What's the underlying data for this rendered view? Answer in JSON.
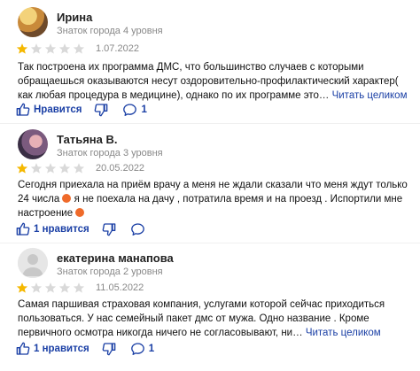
{
  "reviews": [
    {
      "name": "Ирина",
      "level": "Знаток города 4 уровня",
      "rating": 1,
      "date": "1.07.2022",
      "text": "Так построена их программа ДМС, что большинство случаев с которыми обращаешься оказываются несут оздоровительно-профилактический характер( как любая процедура в медицине), однако по их программе это…",
      "more": "Читать целиком",
      "likes": "Нравится",
      "comments": "1"
    },
    {
      "name": "Татьяна В.",
      "level": "Знаток города 3 уровня",
      "rating": 1,
      "date": "20.05.2022",
      "text_part1": "Сегодня приехала на приём врачу а меня не ждали сказали что меня ждут только 24 числа",
      "text_part2": "я не поехала на дачу , потратила время и на проезд . Испортили мне настроение",
      "likes": "1 нравится",
      "comments": ""
    },
    {
      "name": "екатерина манапова",
      "level": "Знаток города 2 уровня",
      "rating": 1,
      "date": "11.05.2022",
      "text": "Самая паршивая страховая компания, услугами которой сейчас приходиться пользоваться. У нас семейный пакет дмс от мужа. Одно название . Кроме первичного осмотра никогда ничего не согласовывают, ни…",
      "more": "Читать целиком",
      "likes": "1 нравится",
      "comments": "1"
    }
  ],
  "colors": {
    "star_filled": "#f5b800",
    "star_empty": "#d9d9d9",
    "link": "#1a3fa5"
  },
  "icons": [
    "thumb-up-icon",
    "thumb-down-icon",
    "comment-icon",
    "star-icon",
    "default-avatar-icon"
  ]
}
